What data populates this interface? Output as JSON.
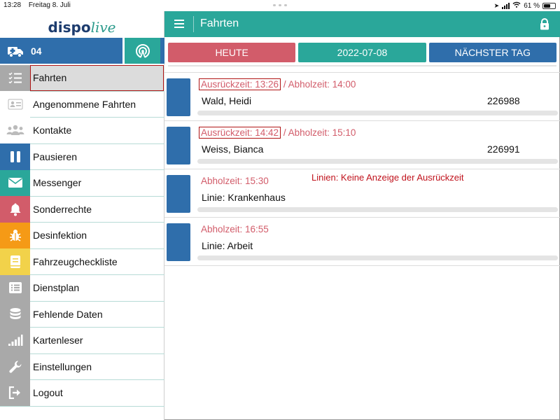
{
  "status": {
    "time": "13:28",
    "date": "Freitag 8. Juli",
    "battery": "61 %",
    "battery_level": 0.61
  },
  "logo": {
    "part1": "dispo",
    "part2": "live"
  },
  "unit": {
    "number": "04"
  },
  "menu": [
    {
      "label": "Fahrten",
      "icon": "list-check-icon",
      "color": "#a9a9a9",
      "active": true
    },
    {
      "label": "Angenommene Fahrten",
      "icon": "id-card-icon",
      "color": "#ffffff"
    },
    {
      "label": "Kontakte",
      "icon": "contacts-icon",
      "color": "#ffffff"
    },
    {
      "label": "Pausieren",
      "icon": "pause-icon",
      "color": "#2f6eab"
    },
    {
      "label": "Messenger",
      "icon": "envelope-icon",
      "color": "#2aa79a"
    },
    {
      "label": "Sonderrechte",
      "icon": "bell-icon",
      "color": "#d25c6a"
    },
    {
      "label": "Desinfektion",
      "icon": "bug-icon",
      "color": "#f59a16"
    },
    {
      "label": "Fahrzeugcheckliste",
      "icon": "book-icon",
      "color": "#f2d24a"
    },
    {
      "label": "Dienstplan",
      "icon": "list-icon",
      "color": "#a9a9a9"
    },
    {
      "label": "Fehlende Daten",
      "icon": "database-icon",
      "color": "#a9a9a9"
    },
    {
      "label": "Kartenleser",
      "icon": "signal-icon",
      "color": "#a9a9a9"
    },
    {
      "label": "Einstellungen",
      "icon": "wrench-icon",
      "color": "#a9a9a9"
    },
    {
      "label": "Logout",
      "icon": "logout-icon",
      "color": "#a9a9a9"
    }
  ],
  "header": {
    "title": "Fahrten"
  },
  "tabs": {
    "today": "HEUTE",
    "date": "2022-07-08",
    "next": "NÄCHSTER TAG"
  },
  "trips": [
    {
      "departure": "Ausrückzeit: 13:26",
      "pickup": " / Abholzeit: 14:00",
      "name": "Wald, Heidi",
      "number": "226988"
    },
    {
      "departure": "Ausrückzeit: 14:42",
      "pickup": " / Abholzeit: 15:10",
      "name": "Weiss, Bianca",
      "number": "226991"
    },
    {
      "pickup": "Abholzeit: 15:30",
      "name": "Linie: Krankenhaus",
      "note": "Linien: Keine Anzeige der Ausrückzeit"
    },
    {
      "pickup": "Abholzeit: 16:55",
      "name": "Linie: Arbeit"
    }
  ]
}
